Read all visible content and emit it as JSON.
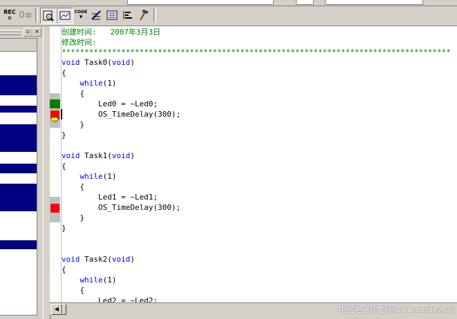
{
  "toolbar": {
    "rec_label": "REC",
    "code_label": "CODE",
    "buttons": [
      "rec-icon",
      "step-icon",
      "disassembly-icon",
      "memory-window-icon",
      "code-coverage-icon",
      "serial-window-icon",
      "logic-analyzer-icon",
      "performance-icon",
      "build-tool-icon"
    ]
  },
  "left_panel": {
    "close_label": "×",
    "restore_label": "▫"
  },
  "editor": {
    "lines": [
      {
        "text": "创建时间:   2007年3月3日",
        "type": "comment"
      },
      {
        "text": "修改时间:",
        "type": "comment"
      },
      {
        "text": "*************************************************************************************",
        "type": "comment"
      },
      {
        "text": "void Task0(void)",
        "type": "code"
      },
      {
        "text": "{",
        "type": "code"
      },
      {
        "text": "    while(1)",
        "type": "code"
      },
      {
        "text": "    {",
        "type": "code"
      },
      {
        "text": "        Led0 = ~Led0;",
        "type": "code"
      },
      {
        "text": "        OS_TimeDelay(300);",
        "type": "code"
      },
      {
        "text": "    }",
        "type": "code"
      },
      {
        "text": "}",
        "type": "code"
      },
      {
        "text": "",
        "type": "code"
      },
      {
        "text": "void Task1(void)",
        "type": "code"
      },
      {
        "text": "{",
        "type": "code"
      },
      {
        "text": "    while(1)",
        "type": "code"
      },
      {
        "text": "    {",
        "type": "code"
      },
      {
        "text": "        Led1 = ~Led1;",
        "type": "code"
      },
      {
        "text": "        OS_TimeDelay(300);",
        "type": "code"
      },
      {
        "text": "    }",
        "type": "code"
      },
      {
        "text": "}",
        "type": "code"
      },
      {
        "text": "",
        "type": "code"
      },
      {
        "text": "",
        "type": "code"
      },
      {
        "text": "void Task2(void)",
        "type": "code"
      },
      {
        "text": "{",
        "type": "code"
      },
      {
        "text": "    while(1)",
        "type": "code"
      },
      {
        "text": "    {",
        "type": "code"
      },
      {
        "text": "        Led2 = ~Led2;",
        "type": "code"
      }
    ]
  },
  "colors": {
    "comment": "#008000",
    "keyword": "#0000ff",
    "nav_bar": "#000080",
    "breakpoint": "#ff0000",
    "coverage": "#008000"
  },
  "watermark": "中国电子开发网(www.ourdev.cn)"
}
